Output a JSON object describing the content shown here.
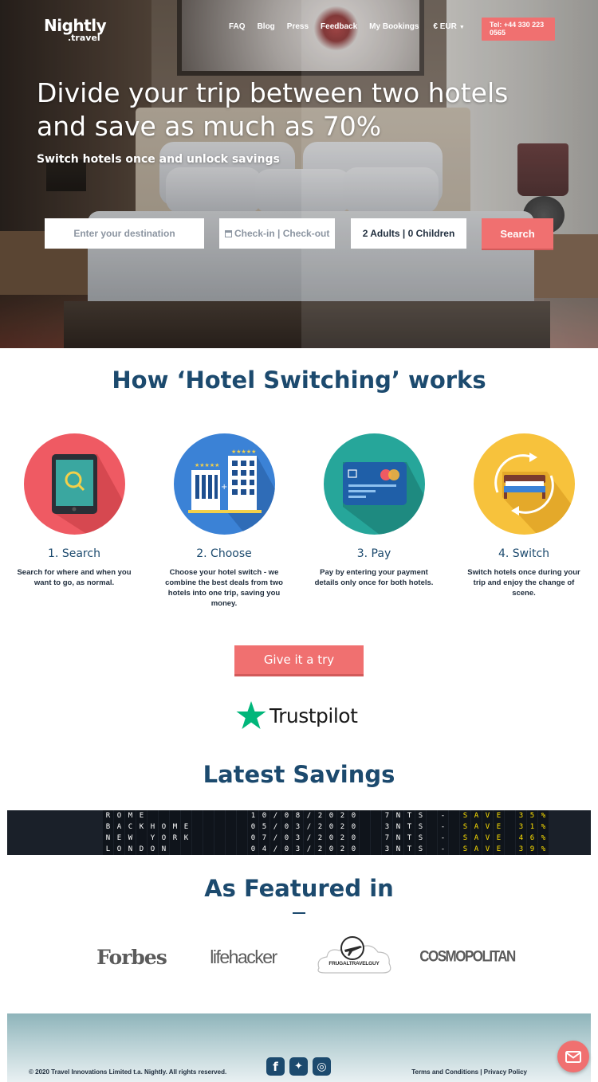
{
  "brand": {
    "name": "Nightly",
    "suffix": ".travel"
  },
  "nav": {
    "items": [
      "FAQ",
      "Blog",
      "Press",
      "Feedback",
      "My Bookings"
    ],
    "currency": "€ EUR",
    "tel": "Tel: +44 330 223 0565"
  },
  "hero": {
    "title": "Divide your trip between two hotels and save as much as 70%",
    "subtitle": "Switch hotels once and unlock savings",
    "destination_placeholder": "Enter your destination",
    "dates_placeholder": "Check-in | Check-out",
    "guests": "2 Adults | 0 Children",
    "search_label": "Search"
  },
  "how": {
    "title": "How ‘Hotel Switching’ works",
    "steps": [
      {
        "title": "1. Search",
        "desc": "Search for where and when you want to go, as normal.",
        "color": "#ef5a63",
        "icon": "tablet-search-icon"
      },
      {
        "title": "2. Choose",
        "desc": "Choose your hotel switch - we combine the best deals from two hotels into one trip, saving you money.",
        "color": "#3b82d6",
        "icon": "hotels-icon"
      },
      {
        "title": "3. Pay",
        "desc": "Pay by entering your payment details only once for both hotels.",
        "color": "#26a69a",
        "icon": "credit-card-icon"
      },
      {
        "title": "4. Switch",
        "desc": "Switch hotels once during your trip and enjoy the change of scene.",
        "color": "#f7c23c",
        "icon": "bed-switch-icon"
      }
    ]
  },
  "cta": {
    "label": "Give it a try"
  },
  "trustpilot": {
    "label": "Trustpilot"
  },
  "savings": {
    "title": "Latest Savings",
    "rows": [
      {
        "city": "ROME",
        "date": "10/08/2020",
        "nights": "7NTS",
        "save": "SAVE 35%"
      },
      {
        "city": "BACKHOME",
        "date": "05/03/2020",
        "nights": "3NTS",
        "save": "SAVE 31%"
      },
      {
        "city": "NEW YORK",
        "date": "07/03/2020",
        "nights": "7NTS",
        "save": "SAVE 46%"
      },
      {
        "city": "LONDON",
        "date": "04/03/2020",
        "nights": "3NTS",
        "save": "SAVE 39%"
      }
    ]
  },
  "featured": {
    "title": "As Featured in",
    "outlets": [
      "Forbes",
      "lifehacker",
      "FRUGALTRAVELGUY",
      "COSMOPOLITAN"
    ]
  },
  "footer": {
    "copyright": "© 2020 Travel Innovations Limited t.a. Nightly. All rights reserved.",
    "links": "Terms and Conditions | Privacy Policy",
    "social": [
      "facebook-icon",
      "twitter-icon",
      "instagram-icon"
    ]
  },
  "colors": {
    "accent": "#f07070",
    "heading": "#1c4a6e"
  }
}
